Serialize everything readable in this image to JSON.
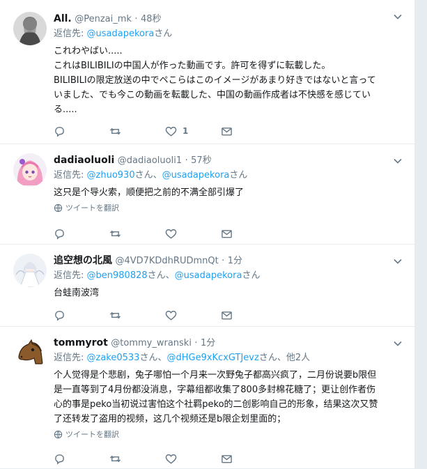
{
  "tweets": [
    {
      "name": "All.",
      "handle": "@Penzai_mk",
      "sep": "·",
      "time": "48秒",
      "reply_prefix": "返信先: ",
      "reply_users": [
        "@usadapekora"
      ],
      "reply_joiners": [
        "さん"
      ],
      "text_lines": [
        "これわやばい.....",
        "これはBILIBILIの中国人が作った動画です。許可を得ずに転載した。",
        "BILIBILIの限定放送の中でペこらはこのイメージがあまり好きではないと言って",
        "いました、でも今この動画を転載した、中国の動画作成者は不快感を感じてい",
        "る....."
      ],
      "translate": "",
      "like_count": "1",
      "avatar_icon": "grey-figure-avatar"
    },
    {
      "name": "dadiaoluoli",
      "handle": "@dadiaoluoli1",
      "sep": "·",
      "time": "57秒",
      "reply_prefix": "返信先: ",
      "reply_users": [
        "@zhuo930",
        "@usadapekora"
      ],
      "reply_joiners": [
        "さん、",
        "さん"
      ],
      "text_lines": [
        "这只是个导火索，顺便把之前的不满全部引爆了"
      ],
      "translate": "ツイートを翻訳",
      "like_count": "",
      "avatar_icon": "pink-hair-anime-avatar"
    },
    {
      "name": "追空想の北風",
      "handle": "@4VD7KDdhRUDmnQt",
      "sep": "·",
      "time": "1分",
      "reply_prefix": "返信先: ",
      "reply_users": [
        "@ben980828",
        "@usadapekora"
      ],
      "reply_joiners": [
        "さん、",
        "さん"
      ],
      "text_lines": [
        "台蛙南波湾"
      ],
      "translate": "",
      "like_count": "",
      "avatar_icon": "white-dress-anime-avatar"
    },
    {
      "name": "tommyrot",
      "handle": "@tommy_wranski",
      "sep": "·",
      "time": "1分",
      "reply_prefix": "返信先: ",
      "reply_users": [
        "@zake0533",
        "@dHGe9xKcxGTJevz"
      ],
      "reply_joiners": [
        "さん、",
        "さん、他2人"
      ],
      "text_lines": [
        "个人觉得是个悲剧，兔子哪怕一个月来一次野兔子都高兴疯了，二月份说要b限但",
        "是一直等到了4月份都没消息，字幕组都收集了800多封棉花糖了；更让创作者伤",
        "心的事是peko当初说过害怕这个社羁peko的二创影响自己的形象，结果这次又赞",
        "了还转发了盗用的视频，这几个视频还是b限企划里面的；"
      ],
      "translate": "ツイートを翻訳",
      "like_count": "",
      "avatar_icon": "horse-head-avatar"
    }
  ],
  "colors": {
    "link": "#1da1f2",
    "muted": "#657786",
    "divider": "#e6ecf0"
  }
}
